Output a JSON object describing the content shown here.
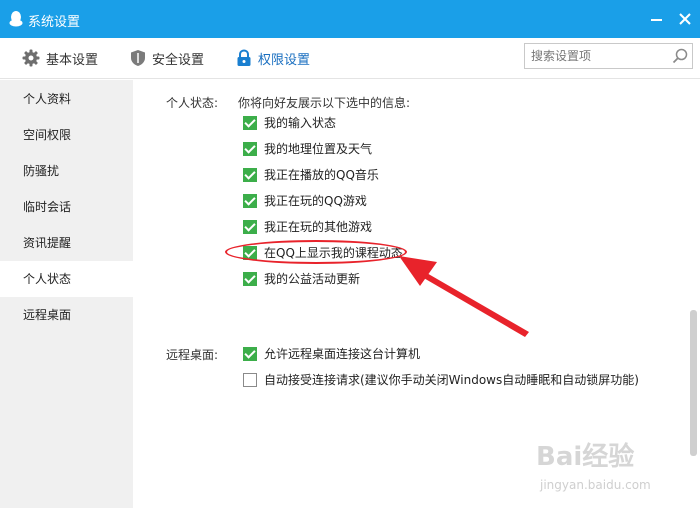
{
  "window": {
    "title": "系统设置"
  },
  "toolbar": {
    "items": [
      {
        "label": "基本设置",
        "icon": "gear-icon"
      },
      {
        "label": "安全设置",
        "icon": "shield-icon"
      },
      {
        "label": "权限设置",
        "icon": "lock-icon",
        "active": true
      }
    ],
    "search_placeholder": "搜索设置项"
  },
  "sidebar": {
    "items": [
      {
        "label": "个人资料"
      },
      {
        "label": "空间权限"
      },
      {
        "label": "防骚扰"
      },
      {
        "label": "临时会话"
      },
      {
        "label": "资讯提醒"
      },
      {
        "label": "个人状态",
        "selected": true
      },
      {
        "label": "远程桌面"
      }
    ]
  },
  "personal_status": {
    "label": "个人状态:",
    "description": "你将向好友展示以下选中的信息:",
    "options": [
      {
        "label": "我的输入状态",
        "checked": true
      },
      {
        "label": "我的地理位置及天气",
        "checked": true
      },
      {
        "label": "我正在播放的QQ音乐",
        "checked": true
      },
      {
        "label": "我正在玩的QQ游戏",
        "checked": true
      },
      {
        "label": "我正在玩的其他游戏",
        "checked": true
      },
      {
        "label": "在QQ上显示我的课程动态",
        "checked": true
      },
      {
        "label": "我的公益活动更新",
        "checked": true
      }
    ]
  },
  "remote_desktop": {
    "label": "远程桌面:",
    "options": [
      {
        "label": "允许远程桌面连接这台计算机",
        "checked": true
      },
      {
        "label": "自动接受连接请求(建议你手动关闭Windows自动睡眠和自动锁屏功能)",
        "checked": false
      }
    ]
  },
  "watermark": {
    "brand": "Bai经验",
    "url": "jingyan.baidu.com"
  },
  "colors": {
    "titlebar": "#1a9fe8",
    "checkbox_checked": "#3cae4a",
    "annotation": "#e8232b",
    "active_tab": "#1a6fc0"
  }
}
